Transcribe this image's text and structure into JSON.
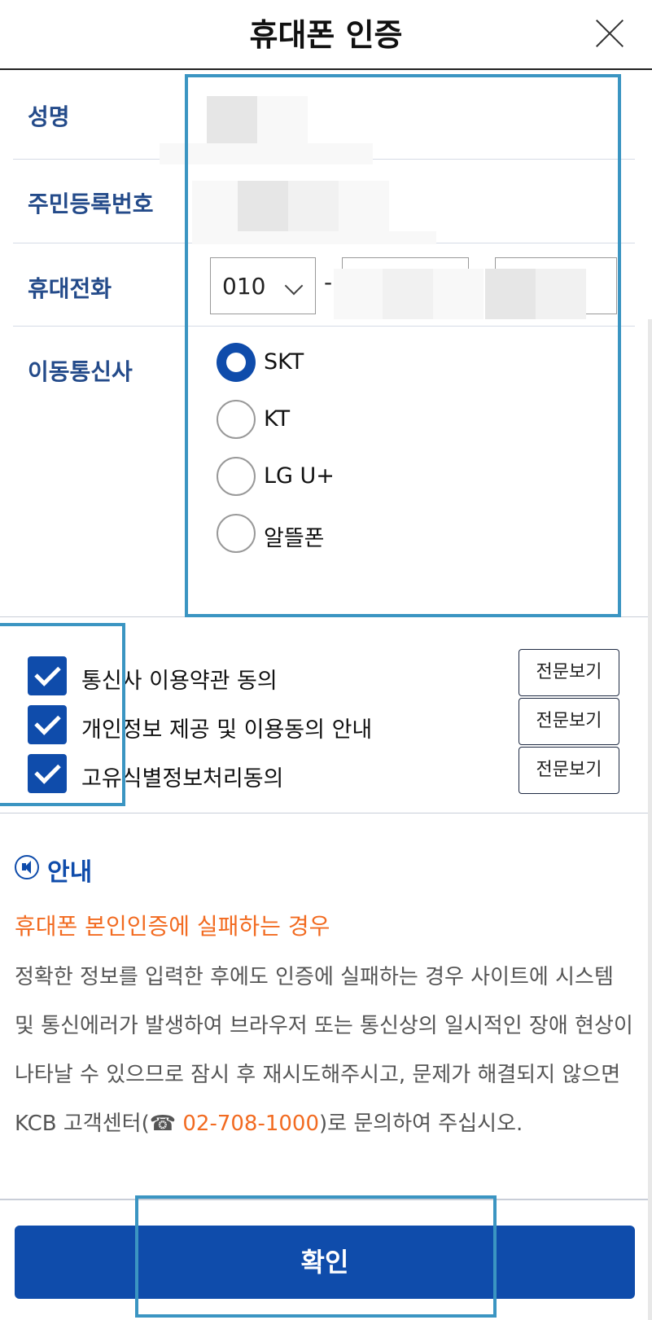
{
  "header": {
    "title": "휴대폰 인증",
    "close_icon": "close-icon"
  },
  "form": {
    "name_label": "성명",
    "ssn_label": "주민등록번호",
    "phone_label": "휴대전화",
    "phone_prefix": "010",
    "phone_separator": "-",
    "carrier_label": "이동통신사",
    "carriers": [
      {
        "label": "SKT",
        "selected": true
      },
      {
        "label": "KT",
        "selected": false
      },
      {
        "label": "LG U+",
        "selected": false
      },
      {
        "label": "알뜰폰",
        "selected": false
      }
    ]
  },
  "agreements": {
    "items": [
      {
        "label": "통신사 이용약관 동의",
        "checked": true,
        "button": "전문보기"
      },
      {
        "label": "개인정보 제공 및 이용동의 안내",
        "checked": true,
        "button": "전문보기"
      },
      {
        "label": "고유식별정보처리동의",
        "checked": true,
        "button": "전문보기"
      }
    ]
  },
  "notice": {
    "title": "안내",
    "subtitle": "휴대폰 본인인증에 실패하는 경우",
    "body_part1": "정확한 정보를 입력한 후에도 인증에 실패하는 경우 사이트에 시스템 및 통신에러가 발생하여 브라우저 또는 통신상의 일시적인 장애 현상이 나타날 수 있으므로 잠시 후 재시도해주시고, 문제가 해결되지 않으면 KCB 고객센터(",
    "phone_glyph": "☎",
    "phone_number": "02-708-1000",
    "body_part2": ")로 문의하여 주십시오."
  },
  "footer": {
    "confirm_label": "확인"
  },
  "colors": {
    "primary": "#0f4cab",
    "label_blue": "#244b8a",
    "accent_orange": "#f26b21",
    "highlight": "#3b95c2"
  }
}
